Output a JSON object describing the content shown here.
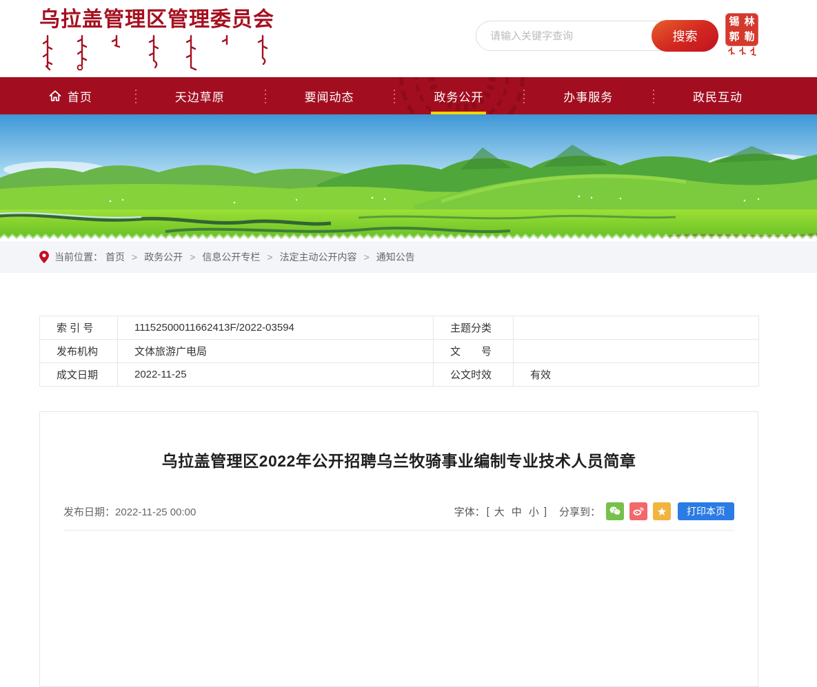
{
  "header": {
    "site_name": "乌拉盖管理区管理委员会",
    "search": {
      "placeholder": "请输入关键字查询",
      "button": "搜索"
    },
    "seal": {
      "chars": [
        "锡",
        "林",
        "郭",
        "勒"
      ]
    }
  },
  "nav": {
    "items": [
      {
        "label": "首页",
        "active": false
      },
      {
        "label": "天边草原",
        "active": false
      },
      {
        "label": "要闻动态",
        "active": false
      },
      {
        "label": "政务公开",
        "active": true
      },
      {
        "label": "办事服务",
        "active": false
      },
      {
        "label": "政民互动",
        "active": false
      }
    ]
  },
  "breadcrumb": {
    "label": "当前位置：",
    "separator": ">",
    "items": [
      "首页",
      "政务公开",
      "信息公开专栏",
      "法定主动公开内容",
      "通知公告"
    ]
  },
  "doc_info": {
    "rows": [
      {
        "label_left": "索 引 号",
        "value_left": "11152500011662413F/2022-03594",
        "label_right": "主题分类",
        "value_right": ""
      },
      {
        "label_left": "发布机构",
        "value_left": "文体旅游广电局",
        "label_right": "文　　号",
        "value_right": ""
      },
      {
        "label_left": "成文日期",
        "value_left": "2022-11-25",
        "label_right": "公文时效",
        "value_right": "有效"
      }
    ]
  },
  "article": {
    "title": "乌拉盖管理区2022年公开招聘乌兰牧骑事业编制专业技术人员简章",
    "publish_date_label": "发布日期：",
    "publish_date_value": "2022-11-25 00:00",
    "font_label": "字体：",
    "bracket_open": "[",
    "bracket_close": "]",
    "font_options": [
      "大",
      "中",
      "小"
    ],
    "share_label": "分享到：",
    "print_button": "打印本页"
  },
  "icons": {
    "home": "home-icon",
    "location": "location-pin-icon",
    "wechat": "wechat-share-icon",
    "weibo": "weibo-share-icon",
    "star": "favorite-share-icon"
  },
  "colors": {
    "nav_red": "#A20E20",
    "logo_red": "#A5101F",
    "accent_yellow": "#FFD400",
    "search_button_red": "#D42A20",
    "wechat_green": "#76C14B",
    "weibo_red": "#F2686B",
    "star_yellow": "#F2B43F",
    "print_blue": "#2B7BE4",
    "breadcrumb_bg": "#F3F5F9"
  }
}
